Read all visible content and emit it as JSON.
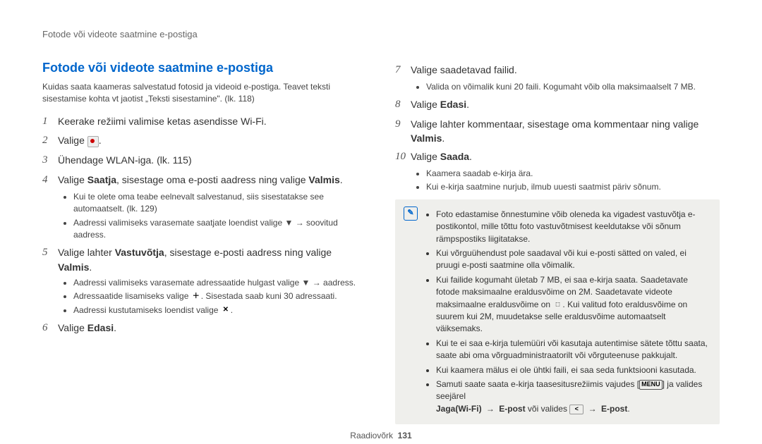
{
  "header": "Fotode või videote saatmine e-postiga",
  "section_title": "Fotode või videote saatmine e-postiga",
  "intro": "Kuidas saata kaameras salvestatud fotosid ja videoid e-postiga. Teavet teksti sisestamise kohta vt jaotist „Teksti sisestamine\". (lk. 118)",
  "steps": {
    "s1": "Keerake režiimi valimise ketas asendisse ",
    "s1_tail": ".",
    "s2": "Valige ",
    "s2_tail": ".",
    "s3": "Ühendage WLAN-iga. (lk. 115)",
    "s4_a": "Valige ",
    "s4_b": "Saatja",
    "s4_c": ", sisestage oma e-posti aadress ning valige ",
    "s4_d": "Valmis",
    "s4_e": ".",
    "s4_sub1": "Kui te olete oma teabe eelnevalt salvestanud, siis sisestatakse see automaatselt. (lk. 129)",
    "s4_sub2_a": "Aadressi valimiseks varasemate saatjate loendist valige ",
    "s4_sub2_b": " → soovitud aadress.",
    "s5_a": "Valige lahter ",
    "s5_b": "Vastuvõtja",
    "s5_c": ", sisestage e-posti aadress ning valige ",
    "s5_d": "Valmis",
    "s5_e": ".",
    "s5_sub1_a": "Aadressi valimiseks varasemate adressaatide hulgast valige ",
    "s5_sub1_b": " → aadress.",
    "s5_sub2_a": "Adressaatide lisamiseks valige ",
    "s5_sub2_b": ". Sisestada saab kuni 30 adressaati.",
    "s5_sub3_a": "Aadressi kustutamiseks loendist valige ",
    "s5_sub3_b": ".",
    "s6": "Valige ",
    "s6_b": "Edasi",
    "s6_c": ".",
    "s7": "Valige saadetavad failid.",
    "s7_sub1": "Valida on võimalik kuni 20 faili. Kogumaht võib olla maksimaalselt 7 MB.",
    "s8": "Valige ",
    "s8_b": "Edasi",
    "s8_c": ".",
    "s9_a": "Valige lahter kommentaar, sisestage oma kommentaar ning valige ",
    "s9_b": "Valmis",
    "s9_c": ".",
    "s10": "Valige ",
    "s10_b": "Saada",
    "s10_c": ".",
    "s10_sub1": "Kaamera saadab e-kirja ära.",
    "s10_sub2": "Kui e-kirja saatmine nurjub, ilmub uuesti saatmist päriv sõnum."
  },
  "info": {
    "i1": "Foto edastamise õnnestumine võib oleneda ka vigadest vastuvõtja e-postikontol, mille tõttu foto vastuvõtmisest keeldutakse või sõnum rämpspostiks liigitatakse.",
    "i2": "Kui võrguühendust pole saadaval või kui e-posti sätted on valed, ei pruugi e-posti saatmine olla võimalik.",
    "i3_a": "Kui failide kogumaht ületab 7 MB, ei saa e-kirja saata. Saadetavate fotode maksimaalne eraldusvõime on 2M. Saadetavate videote maksimaalne eraldusvõime on ",
    "i3_b": ". Kui valitud foto eraldusvõime on suurem kui 2M, muudetakse selle eraldusvõime automaatselt väiksemaks.",
    "i4": "Kui te ei saa e-kirja tulemüüri või kasutaja autentimise sätete tõttu saata, saate abi oma võrguadministraatorilt või võrguteenuse pakkujalt.",
    "i5": "Kui kaamera mälus ei ole ühtki faili, ei saa seda funktsiooni kasutada.",
    "i6_a": "Samuti saate saata e-kirja taasesitusrežiimis vajudes [",
    "i6_menu": "MENU",
    "i6_b": "] ja valides seejärel ",
    "i6_c": "Jaga(Wi-Fi)",
    "i6_d": "E-post",
    "i6_e": " või valides ",
    "i6_f": "E-post",
    "i6_g": "."
  },
  "footer_label": "Raadiovõrk",
  "footer_page": "131",
  "icons": {
    "wifi_label": "Wi-Fi",
    "down_arrow": "▼",
    "plus": "＋",
    "x": "✕",
    "resolution": "⬚",
    "share": "<",
    "arrow": "→"
  }
}
